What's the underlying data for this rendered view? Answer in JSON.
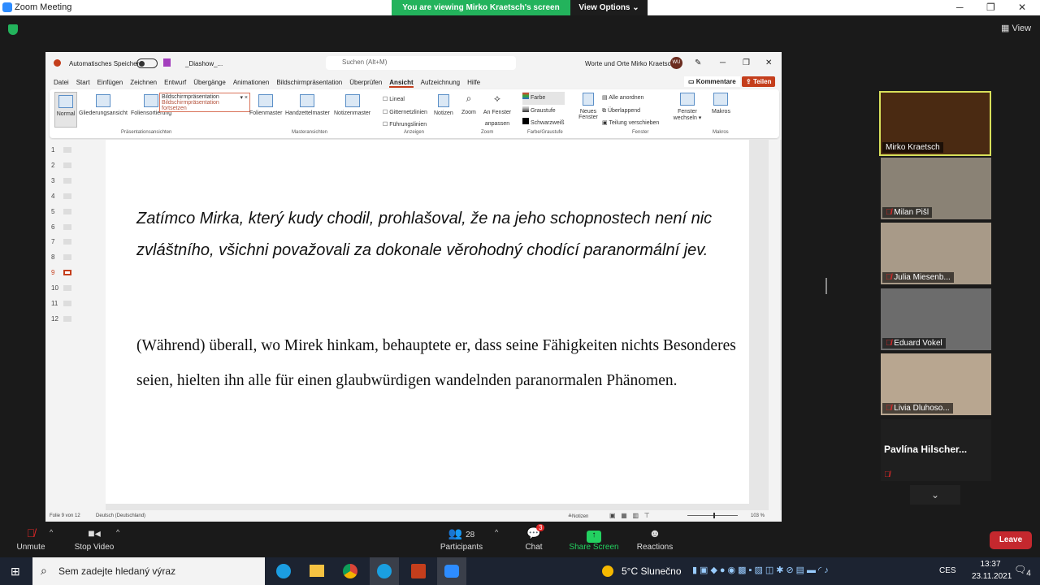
{
  "window": {
    "title": "Zoom Meeting",
    "banner": "You are viewing Mirko Kraetsch's screen",
    "view_options": "View Options",
    "view": "View"
  },
  "ppt": {
    "autosave": "Automatisches Speichern",
    "filename": "_Diashow_...",
    "search": "Suchen (Alt+M)",
    "doc_title": "Worte und Orte Mirko Kraetsch",
    "user_initials": "WU",
    "menu": [
      "Datei",
      "Start",
      "Einfügen",
      "Zeichnen",
      "Entwurf",
      "Übergänge",
      "Animationen",
      "Bildschirmpräsentation",
      "Überprüfen",
      "Ansicht",
      "Aufzeichnung",
      "Hilfe"
    ],
    "active_menu": "Ansicht",
    "comments": "Kommentare",
    "share": "Teilen",
    "ribbon": {
      "normal": "Normal",
      "outline": "Gliederungsansicht",
      "sorter": "Foliensortierung",
      "popup_title": "Bildschirmpräsentation",
      "popup_link": "Bildschirmpräsentation fortsetzen",
      "slide_master": "Folienmaster",
      "handout_master": "Handzettelmaster",
      "notes_master": "Notizenmaster",
      "ruler": "Lineal",
      "gridlines": "Gitternetzlinien",
      "guides": "Führungslinien",
      "notes": "Notizen",
      "zoom": "Zoom",
      "fit": "An Fenster anpassen",
      "color": "Farbe",
      "grayscale": "Graustufe",
      "bw": "Schwarzweiß",
      "new_window": "Neues Fenster",
      "arrange_all": "Alle anordnen",
      "cascade": "Überlappend",
      "move_split": "Teilung verschieben",
      "switch_windows": "Fenster wechseln",
      "macros": "Makros",
      "groups": [
        "Präsentationsansichten",
        "Masteransichten",
        "Anzeigen",
        "Zoom",
        "Farbe/Graustufe",
        "Fenster",
        "Makros"
      ]
    },
    "thumbs": [
      "1",
      "2",
      "3",
      "4",
      "5",
      "6",
      "7",
      "8",
      "9",
      "10",
      "11",
      "12"
    ],
    "slide": {
      "p1": "Zatímco Mirka, který kudy chodil, prohlašoval, že na jeho schopnostech není nic zvláštního, všichni považovali za dokonale věrohodný chodící paranormální jev.",
      "p2": "(Während) überall, wo Mirek hinkam, behauptete er, dass seine Fähigkeiten nichts Besonderes seien, hielten ihn alle für einen glaubwürdigen wandelnden paranormalen Phänomen."
    },
    "status": {
      "slide": "Folie 9 von 12",
      "lang": "Deutsch (Deutschland)",
      "notes": "Notizen",
      "zoom": "103 %"
    }
  },
  "participants": [
    {
      "name": "Mirko Kraetsch",
      "muted": false,
      "active": true
    },
    {
      "name": "Milan Pišl",
      "muted": true
    },
    {
      "name": "Julia Miesenb...",
      "muted": true
    },
    {
      "name": "Eduard Vokel",
      "muted": true
    },
    {
      "name": "Livia Dluhoso...",
      "muted": true
    },
    {
      "name": "Pavlína  Hilscher...",
      "muted": true
    }
  ],
  "toolbar": {
    "unmute": "Unmute",
    "stop_video": "Stop Video",
    "participants": "Participants",
    "participant_count": "28",
    "chat": "Chat",
    "chat_badge": "3",
    "share": "Share Screen",
    "reactions": "Reactions",
    "leave": "Leave"
  },
  "taskbar": {
    "search": "Sem zadejte hledaný výraz",
    "weather": "5°C  Slunečno",
    "lang": "CES",
    "time": "13:37",
    "date": "23.11.2021",
    "notif": "4"
  }
}
